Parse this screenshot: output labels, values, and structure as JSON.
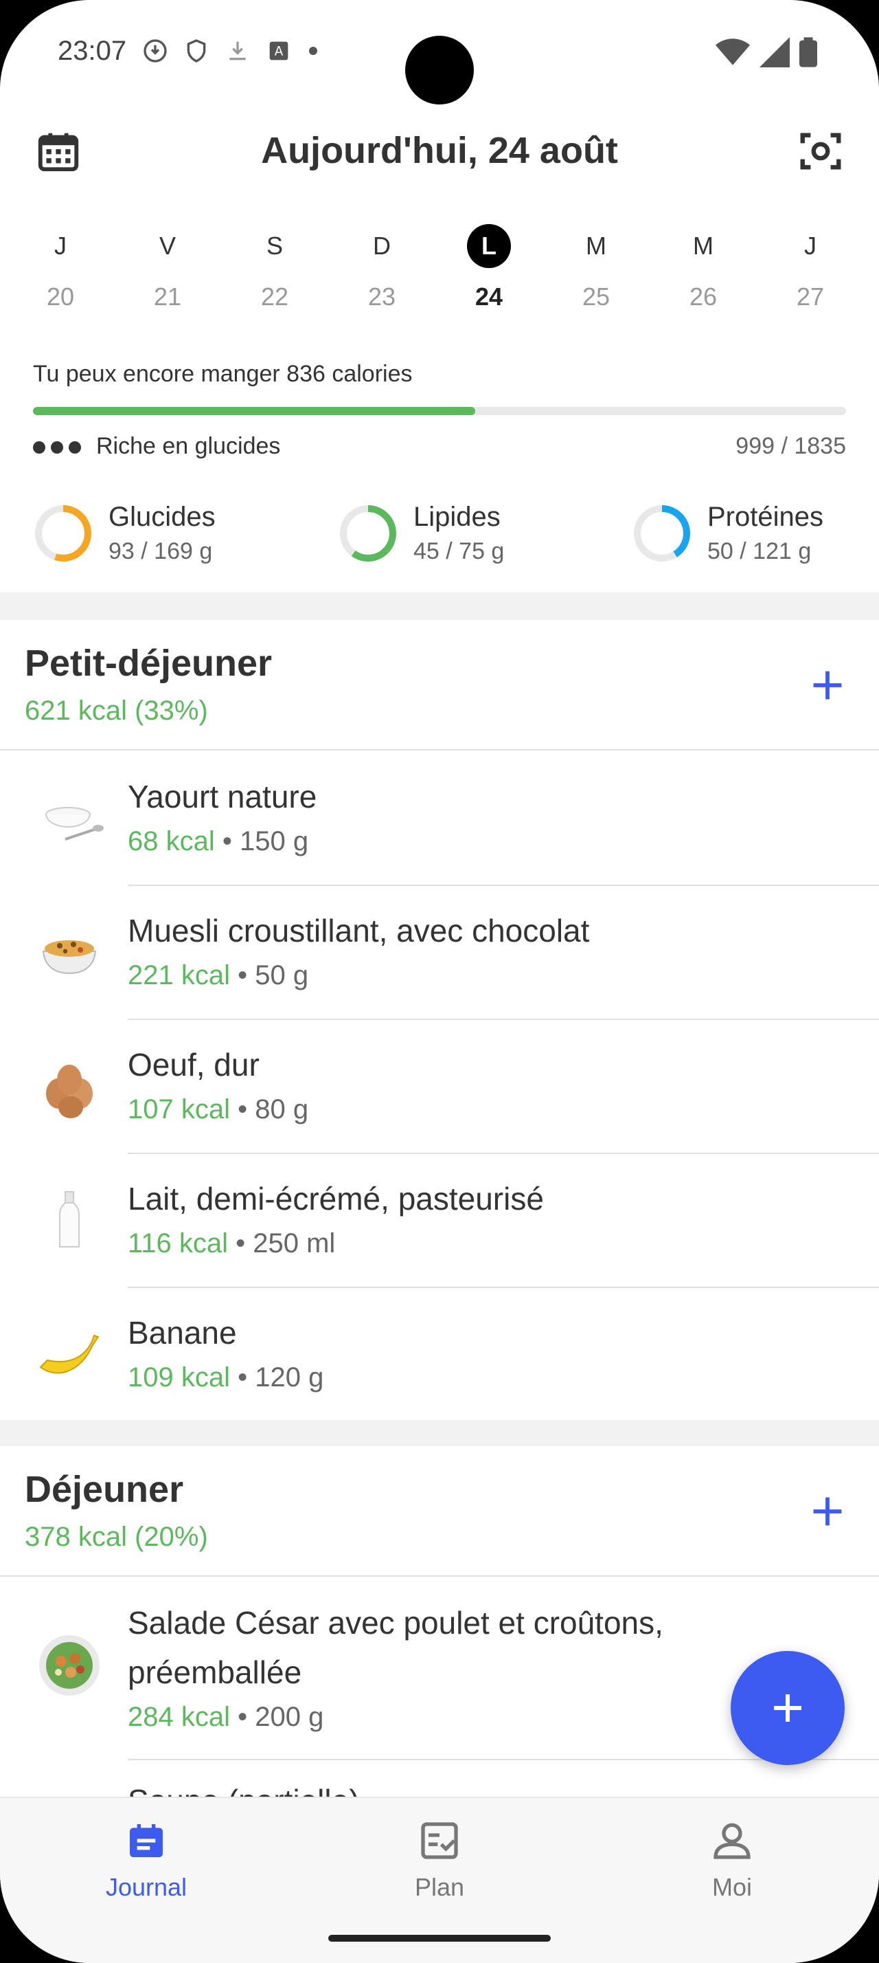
{
  "status": {
    "time": "23:07"
  },
  "header": {
    "title": "Aujourd'hui, 24 août"
  },
  "days": [
    {
      "letter": "J",
      "num": "20",
      "selected": false
    },
    {
      "letter": "V",
      "num": "21",
      "selected": false
    },
    {
      "letter": "S",
      "num": "22",
      "selected": false
    },
    {
      "letter": "D",
      "num": "23",
      "selected": false
    },
    {
      "letter": "L",
      "num": "24",
      "selected": true
    },
    {
      "letter": "M",
      "num": "25",
      "selected": false
    },
    {
      "letter": "M",
      "num": "26",
      "selected": false
    },
    {
      "letter": "J",
      "num": "27",
      "selected": false
    }
  ],
  "summary": {
    "remaining": "Tu peux encore manger 836 calories",
    "progress": 0.544,
    "diet_label": "Riche en glucides",
    "calories": "999 / 1835"
  },
  "macros": [
    {
      "name": "Glucides",
      "value": "93 / 169 g",
      "fraction": 0.55,
      "color": "#f5a623"
    },
    {
      "name": "Lipides",
      "value": "45 / 75 g",
      "fraction": 0.6,
      "color": "#5cb85c"
    },
    {
      "name": "Protéines",
      "value": "50 / 121 g",
      "fraction": 0.41,
      "color": "#1aa3ee"
    }
  ],
  "meals": [
    {
      "title": "Petit-déjeuner",
      "kcal": "621 kcal (33%)",
      "items": [
        {
          "name": "Yaourt nature",
          "kcal": "68 kcal",
          "qty": " • 150 g",
          "icon": "yogurt-icon"
        },
        {
          "name": "Muesli croustillant, avec chocolat",
          "kcal": "221 kcal",
          "qty": " • 50 g",
          "icon": "muesli-icon"
        },
        {
          "name": "Oeuf, dur",
          "kcal": "107 kcal",
          "qty": " • 80 g",
          "icon": "egg-icon"
        },
        {
          "name": "Lait, demi-écrémé, pasteurisé",
          "kcal": "116 kcal",
          "qty": " • 250 ml",
          "icon": "milk-icon"
        },
        {
          "name": "Banane",
          "kcal": "109 kcal",
          "qty": " • 120 g",
          "icon": "banana-icon"
        }
      ]
    },
    {
      "title": "Déjeuner",
      "kcal": "378 kcal (20%)",
      "items": [
        {
          "name": "Salade César avec poulet et croûtons,",
          "name2": "préemballée",
          "kcal": "284 kcal",
          "qty": " • 200 g",
          "icon": "salad-icon"
        },
        {
          "name": "Soupe (partielle)",
          "kcal": "",
          "qty": "",
          "icon": "soup-icon"
        }
      ]
    }
  ],
  "nav": {
    "journal": "Journal",
    "plan": "Plan",
    "moi": "Moi"
  },
  "colors": {
    "accent": "#3d5af1",
    "green": "#5cb85c"
  }
}
